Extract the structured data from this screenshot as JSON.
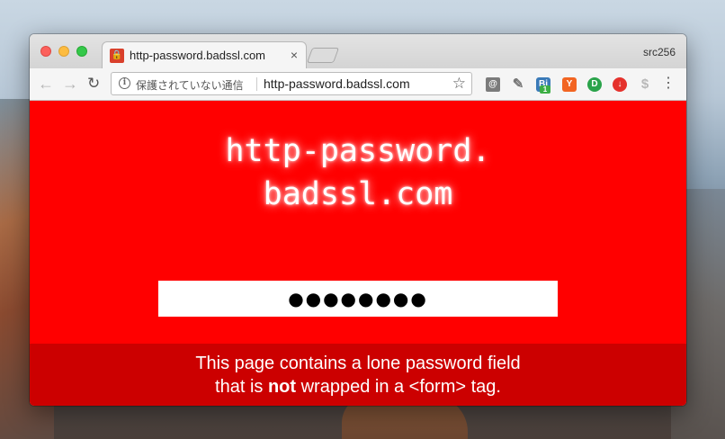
{
  "browser": {
    "tab_title": "http-password.badssl.com",
    "tab_close": "×",
    "profile_name": "src256",
    "security_label": "保護されていない通信",
    "url": "http-password.badssl.com",
    "icons": {
      "back": "arrow-left-icon",
      "forward": "arrow-right-icon",
      "reload": "reload-icon",
      "info": "info-icon",
      "star": "star-icon",
      "menu": "kebab-menu-icon"
    },
    "extensions": [
      {
        "name": "extension-document-icon",
        "glyph": "@"
      },
      {
        "name": "extension-pin-icon",
        "glyph": "✎"
      },
      {
        "name": "extension-bi-icon",
        "glyph": "Bi",
        "badge": "1"
      },
      {
        "name": "extension-y-icon",
        "glyph": "Y"
      },
      {
        "name": "extension-d-icon",
        "glyph": "D"
      },
      {
        "name": "extension-download-icon",
        "glyph": "↓"
      },
      {
        "name": "extension-dollar-icon",
        "glyph": "$"
      }
    ]
  },
  "page": {
    "title_line1": "http-password.",
    "title_line2": "badssl.com",
    "password_value": "●●●●●●●●",
    "footer_line1": "This page contains a lone password field",
    "footer_line2_pre": "that is ",
    "footer_line2_bold": "not",
    "footer_line2_post": " wrapped in a <form> tag.",
    "colors": {
      "page_bg": "#ff0000",
      "footer_bg": "#cc0000"
    }
  }
}
